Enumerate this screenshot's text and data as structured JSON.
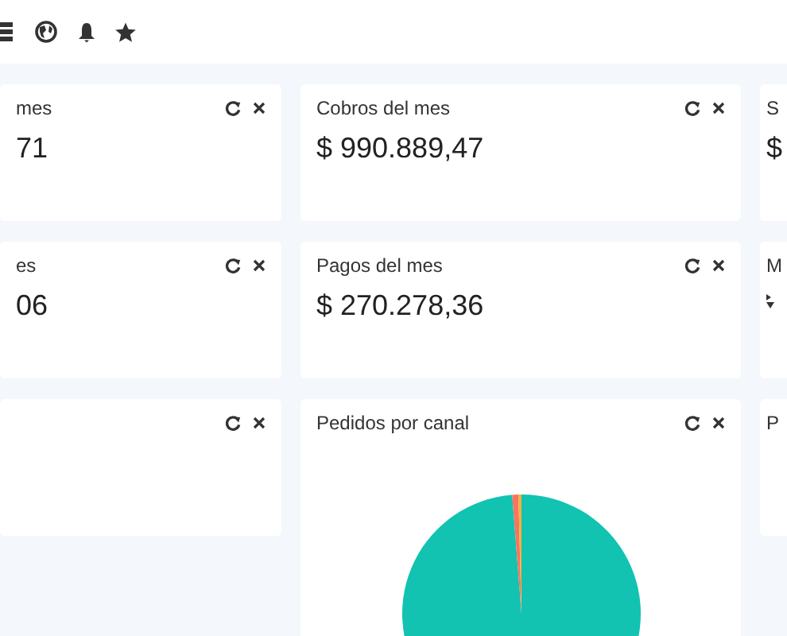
{
  "cards": [
    {
      "kind": "stat",
      "title": "mes",
      "value": "71",
      "actions": true
    },
    {
      "kind": "stat",
      "title": "Cobros del mes",
      "value": "$ 990.889,47",
      "actions": true
    },
    {
      "kind": "stat",
      "title": "S",
      "value": "$",
      "actions": false
    },
    {
      "kind": "stat",
      "title": "es",
      "value": "06",
      "actions": true
    },
    {
      "kind": "stat",
      "title": "Pagos del mes",
      "value": "$ 270.278,36",
      "actions": true
    },
    {
      "kind": "sort",
      "title": "M",
      "actions": false
    },
    {
      "kind": "blank",
      "actions": true
    },
    {
      "kind": "pie",
      "title": "Pedidos por canal",
      "actions": true
    },
    {
      "kind": "blank",
      "title": "P",
      "actions": false
    }
  ]
}
